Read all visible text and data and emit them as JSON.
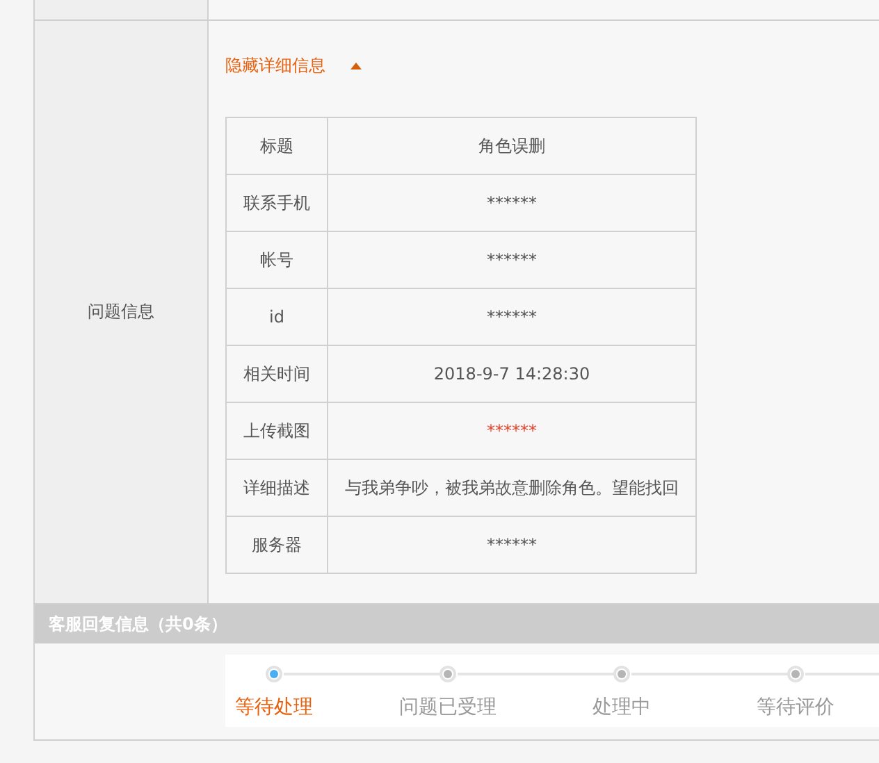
{
  "problem_section": {
    "label": "问题信息",
    "toggle": {
      "label": "隐藏详细信息",
      "expanded": true
    },
    "details": [
      {
        "label": "标题",
        "value": "角色误删",
        "highlighted": false
      },
      {
        "label": "联系手机",
        "value": "******",
        "highlighted": false
      },
      {
        "label": "帐号",
        "value": "******",
        "highlighted": false
      },
      {
        "label": "id",
        "value": "******",
        "highlighted": false
      },
      {
        "label": "相关时间",
        "value": "2018-9-7 14:28:30",
        "highlighted": false
      },
      {
        "label": "上传截图",
        "value": "******",
        "highlighted": true
      },
      {
        "label": "详细描述",
        "value": "与我弟争吵，被我弟故意删除角色。望能找回",
        "highlighted": false
      },
      {
        "label": "服务器",
        "value": "******",
        "highlighted": false
      }
    ]
  },
  "reply_section": {
    "title": "客服回复信息（共0条）"
  },
  "progress_steps": [
    {
      "label": "等待处理",
      "selected": true
    },
    {
      "label": "问题已受理",
      "selected": false
    },
    {
      "label": "处理中",
      "selected": false
    },
    {
      "label": "等待评价",
      "selected": false
    }
  ]
}
